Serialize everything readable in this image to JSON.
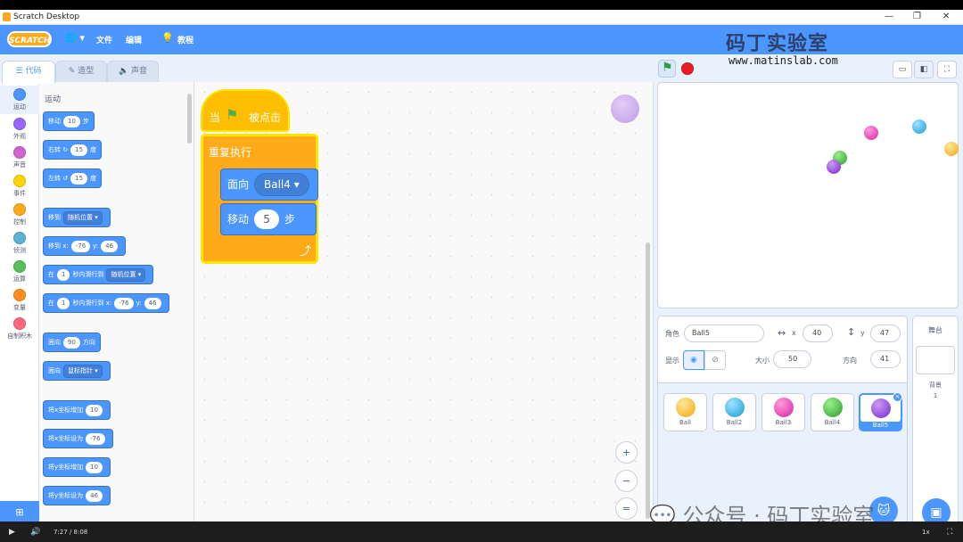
{
  "window": {
    "title": "Scratch Desktop",
    "minimize": "—",
    "maximize": "❐",
    "close": "✕"
  },
  "menubar": {
    "logo": "SCRATCH",
    "file": "文件",
    "edit": "编辑",
    "tutorials": "教程",
    "globe": "🌐 ▾"
  },
  "watermark": {
    "brand": "码丁实验室",
    "url": "www.matinslab.com",
    "wechat": "公众号 · 码丁实验室"
  },
  "tabs": [
    {
      "label": "代码"
    },
    {
      "label": "造型"
    },
    {
      "label": "声音"
    }
  ],
  "categories": [
    {
      "label": "运动",
      "color": "#4c97ff"
    },
    {
      "label": "外观",
      "color": "#9966ff"
    },
    {
      "label": "声音",
      "color": "#cf63cf"
    },
    {
      "label": "事件",
      "color": "#ffd500"
    },
    {
      "label": "控制",
      "color": "#ffab19"
    },
    {
      "label": "侦测",
      "color": "#5cb1d6"
    },
    {
      "label": "运算",
      "color": "#59c059"
    },
    {
      "label": "变量",
      "color": "#ff8c1a"
    },
    {
      "label": "自制积木",
      "color": "#ff6680"
    }
  ],
  "palette": {
    "title": "运动",
    "move": {
      "a": "移动",
      "v": "10",
      "b": "步"
    },
    "turn_right": {
      "a": "右转",
      "v": "15",
      "b": "度"
    },
    "turn_left": {
      "a": "左转",
      "v": "15",
      "b": "度"
    },
    "goto": {
      "a": "移到",
      "dd": "随机位置"
    },
    "goto_xy": {
      "a": "移到 x:",
      "x": "-76",
      "b": "y:",
      "y": "46"
    },
    "glide_to": {
      "a": "在",
      "v": "1",
      "b": "秒内滑行到",
      "dd": "随机位置"
    },
    "glide_xy": {
      "a": "在",
      "v": "1",
      "b": "秒内滑行到 x:",
      "x": "-76",
      "c": "y:",
      "y": "46"
    },
    "point_dir": {
      "a": "面向",
      "v": "90",
      "b": "方向"
    },
    "point_toward": {
      "a": "面向",
      "dd": "鼠标指针"
    },
    "change_x": {
      "a": "将x坐标增加",
      "v": "10"
    },
    "set_x": {
      "a": "将x坐标设为",
      "v": "-76"
    },
    "change_y": {
      "a": "将y坐标增加",
      "v": "10"
    },
    "set_y": {
      "a": "将y坐标设为",
      "v": "46"
    }
  },
  "script": {
    "hat_a": "当",
    "hat_b": "被点击",
    "forever": "重复执行",
    "point_a": "面向",
    "point_v": "Ball4",
    "move_a": "移动",
    "move_v": "5",
    "move_b": "步",
    "loop_arrow": "⤴"
  },
  "zoom": {
    "in": "+",
    "out": "−",
    "reset": "="
  },
  "sprite": {
    "label_sprite": "角色",
    "name": "Ball5",
    "label_x": "x",
    "x": "40",
    "label_y": "y",
    "y": "47",
    "label_show": "显示",
    "label_size": "大小",
    "size": "50",
    "label_dir": "方向",
    "direction": "41"
  },
  "sprites": [
    {
      "name": "Ball",
      "color": "#ffc21a"
    },
    {
      "name": "Ball2",
      "color": "#29a8e6"
    },
    {
      "name": "Ball3",
      "color": "#e63fb8"
    },
    {
      "name": "Ball4",
      "color": "#3cb83c"
    },
    {
      "name": "Ball5",
      "color": "#8a2be2"
    }
  ],
  "stagepanel": {
    "title": "舞台",
    "backdrops_label": "背景",
    "backdrops_count": "1"
  },
  "video": {
    "time": "7:27 / 8:08",
    "speed": "1x"
  }
}
